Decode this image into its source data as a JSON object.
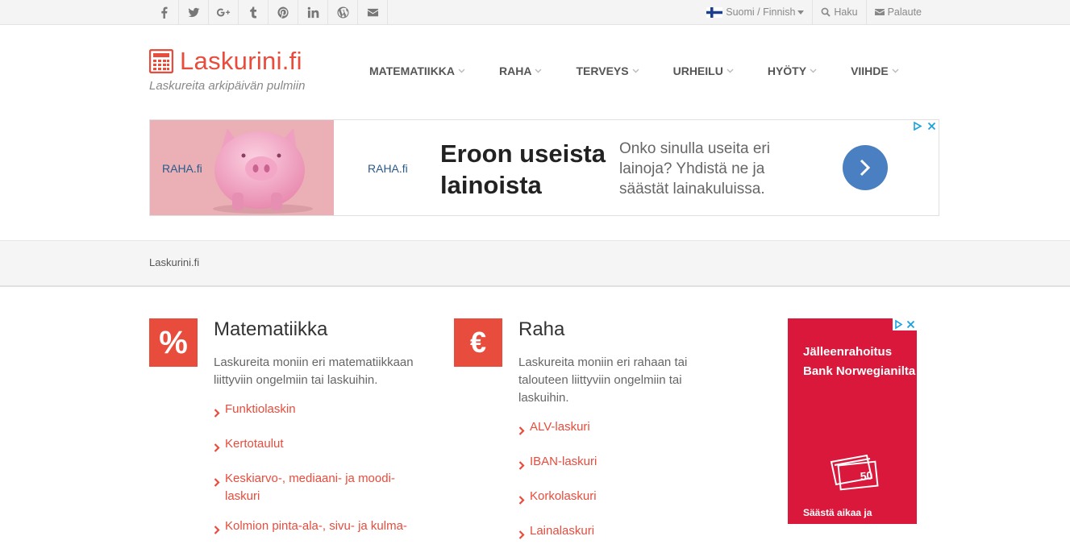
{
  "topbar": {
    "social_icons": [
      "facebook-icon",
      "twitter-icon",
      "google-plus-icon",
      "tumblr-icon",
      "pinterest-icon",
      "linkedin-icon",
      "wordpress-icon",
      "envelope-icon"
    ],
    "language": "Suomi / Finnish",
    "search": "Haku",
    "feedback": "Palaute"
  },
  "header": {
    "logo": "Laskurini.fi",
    "tagline": "Laskureita arkipäivän pulmiin"
  },
  "nav": [
    {
      "label": "MATEMATIIKKA"
    },
    {
      "label": "RAHA"
    },
    {
      "label": "TERVEYS"
    },
    {
      "label": "URHEILU"
    },
    {
      "label": "HYÖTY"
    },
    {
      "label": "VIIHDE"
    }
  ],
  "ad": {
    "brand": "RAHA.fi",
    "headline": "Eroon useista lainoista",
    "description": "Onko sinulla useita eri lainoja? Yhdistä ne ja säästät lainakuluissa."
  },
  "breadcrumb": "Laskurini.fi",
  "categories": [
    {
      "icon_symbol": "%",
      "title": "Matematiikka",
      "description": "Laskureita moniin eri matematiikkaan liittyviin ongelmiin tai laskuihin.",
      "links": [
        "Funktiolaskin",
        "Kertotaulut",
        "Keskiarvo-, mediaani- ja moodi-laskuri",
        "Kolmion pinta-ala-, sivu- ja kulma-"
      ]
    },
    {
      "icon_symbol": "€",
      "title": "Raha",
      "description": "Laskureita moniin eri rahaan tai talouteen liittyviin ongelmiin tai laskuihin.",
      "links": [
        "ALV-laskuri",
        "IBAN-laskuri",
        "Korkolaskuri",
        "Lainalaskuri"
      ]
    }
  ],
  "side_ad": {
    "headline": "Jälleenrahoitus Bank Norwegianilta",
    "note_value": "50",
    "footer": "Säästä aikaa ja"
  },
  "colors": {
    "accent": "#e74c3c",
    "side_ad_bg": "#d9183b",
    "ad_button": "#4a7fc1"
  }
}
